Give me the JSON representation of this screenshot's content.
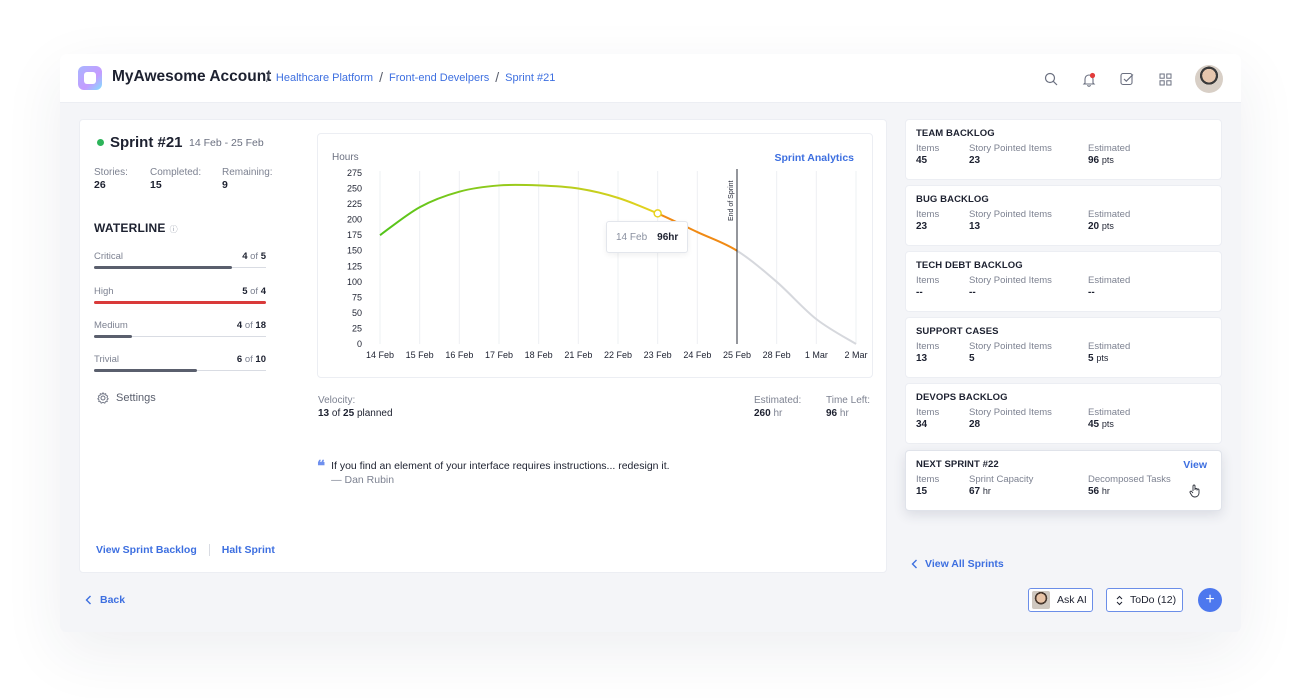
{
  "header": {
    "account": "MyAwesome Account",
    "breadcrumb": [
      "Healthcare Platform",
      "Front-end Develpers",
      "Sprint #21"
    ],
    "icons": [
      "search-icon",
      "bell-icon",
      "checkbox-icon",
      "grid-icon",
      "avatar"
    ]
  },
  "sprint": {
    "title": "Sprint #21",
    "dates": "14 Feb - 25 Feb",
    "status_color": "#2db45a",
    "stats": [
      {
        "label": "Stories:",
        "value": "26"
      },
      {
        "label": "Completed:",
        "value": "15"
      },
      {
        "label": "Remaining:",
        "value": "9"
      }
    ]
  },
  "waterline": {
    "title": "WATERLINE",
    "info_icon": "info-icon",
    "rows": [
      {
        "label": "Critical",
        "done": "4",
        "of": "of",
        "total": "5",
        "fraction": 0.8,
        "color": "#5a5f6d"
      },
      {
        "label": "High",
        "done": "5",
        "of": "of",
        "total": "4",
        "fraction": 1.0,
        "color": "#d93a3a"
      },
      {
        "label": "Medium",
        "done": "4",
        "of": "of",
        "total": "18",
        "fraction": 0.22,
        "color": "#5a5f6d"
      },
      {
        "label": "Trivial",
        "done": "6",
        "of": "of",
        "total": "10",
        "fraction": 0.6,
        "color": "#5a5f6d"
      }
    ],
    "settings_label": "Settings"
  },
  "links": {
    "view_backlog": "View Sprint Backlog",
    "halt": "Halt Sprint",
    "view_all": "View All Sprints",
    "back": "Back"
  },
  "chart_data": {
    "type": "line",
    "ylabel": "Hours",
    "link_label": "Sprint Analytics",
    "x": [
      "14 Feb",
      "15 Feb",
      "16 Feb",
      "17 Feb",
      "18 Feb",
      "21 Feb",
      "22 Feb",
      "23 Feb",
      "24 Feb",
      "25 Feb",
      "28 Feb",
      "1 Mar",
      "2 Mar"
    ],
    "y_ticks": [
      0,
      25,
      50,
      75,
      100,
      125,
      150,
      175,
      200,
      225,
      250,
      275
    ],
    "ylim": [
      0,
      275
    ],
    "series": [
      {
        "values": [
          175,
          220,
          245,
          255,
          255,
          250,
          235,
          210,
          180,
          150,
          100,
          40,
          0
        ]
      }
    ],
    "end_of_sprint_label": "End of Sprint",
    "end_of_sprint_at": "25 Feb",
    "tooltip": {
      "date": "14 Feb",
      "value": "96hr",
      "at_index": 7
    },
    "colors": {
      "start": "#52c41a",
      "mid": "#e8d21e",
      "late": "#f08a14",
      "after": "#d6d8dd"
    }
  },
  "metrics": {
    "velocity_label": "Velocity:",
    "velocity_done": "13",
    "velocity_of": "of",
    "velocity_total": "25",
    "velocity_suffix": "planned",
    "estimated_label": "Estimated:",
    "estimated_value": "260",
    "estimated_unit": "hr",
    "time_left_label": "Time Left:",
    "time_left_value": "96",
    "time_left_unit": "hr"
  },
  "quote": {
    "text": "If you find an element of your interface requires instructions... redesign it.",
    "author": "— Dan Rubin"
  },
  "backlogs": [
    {
      "title": "TEAM BACKLOG",
      "c1_label": "Items",
      "c1": "45",
      "c2_label": "Story Pointed Items",
      "c2": "23",
      "c3_label": "Estimated",
      "c3": "96",
      "c3_unit": "pts"
    },
    {
      "title": "BUG BACKLOG",
      "c1_label": "Items",
      "c1": "23",
      "c2_label": "Story Pointed Items",
      "c2": "13",
      "c3_label": "Estimated",
      "c3": "20",
      "c3_unit": "pts"
    },
    {
      "title": "TECH DEBT BACKLOG",
      "c1_label": "Items",
      "c1": "--",
      "c2_label": "Story Pointed Items",
      "c2": "--",
      "c3_label": "Estimated",
      "c3": "--",
      "c3_unit": ""
    },
    {
      "title": "SUPPORT CASES",
      "c1_label": "Items",
      "c1": "13",
      "c2_label": "Story Pointed Items",
      "c2": "5",
      "c3_label": "Estimated",
      "c3": "5",
      "c3_unit": "pts"
    },
    {
      "title": "DEVOPS BACKLOG",
      "c1_label": "Items",
      "c1": "34",
      "c2_label": "Story Pointed Items",
      "c2": "28",
      "c3_label": "Estimated",
      "c3": "45",
      "c3_unit": "pts"
    },
    {
      "title": "NEXT SPRINT #22",
      "c1_label": "Items",
      "c1": "15",
      "c2_label": "Sprint Capacity",
      "c2": "67",
      "c2_unit": "hr",
      "c3_label": "Decomposed Tasks",
      "c3": "56",
      "c3_unit": "hr",
      "view": "View"
    }
  ],
  "footer": {
    "ask_ai": "Ask AI",
    "todo": "ToDo (12)",
    "plus": "+"
  }
}
